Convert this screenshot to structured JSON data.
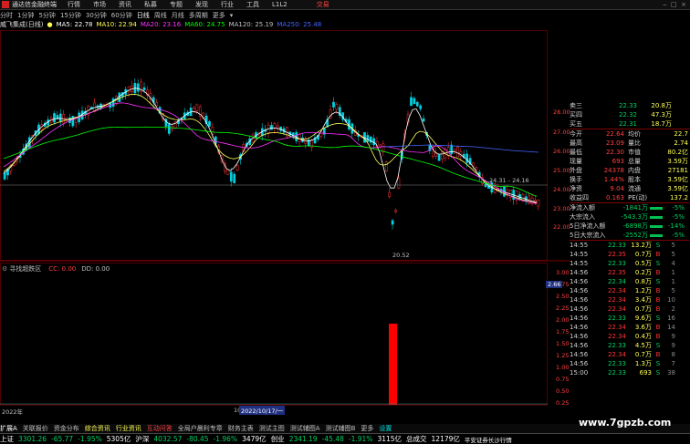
{
  "titlebar": {
    "app_name": "通达信金融终端",
    "menu": [
      "行情",
      "市场",
      "资讯",
      "私募",
      "专题",
      "发现",
      "行业",
      "工具",
      "L1L2"
    ],
    "trade_label": "交易"
  },
  "timeframes": [
    "分时",
    "1分钟",
    "5分钟",
    "15分钟",
    "30分钟",
    "60分钟",
    "日线",
    "周线",
    "月线",
    "多周期",
    "更多"
  ],
  "active_timeframe": "日线",
  "ma_bar": {
    "stock": "威飞集成(日线)",
    "items": [
      {
        "label": "MA5: 22.78",
        "color": "#ffffff"
      },
      {
        "label": "MA10: 22.94",
        "color": "#ffff55"
      },
      {
        "label": "MA20: 23.16",
        "color": "#ff33ff"
      },
      {
        "label": "MA60: 24.75",
        "color": "#00ff00"
      },
      {
        "label": "MA120: 25.19",
        "color": "#c0c0c0"
      },
      {
        "label": "MA250: 25.48",
        "color": "#4466ff"
      }
    ]
  },
  "price_axis": [
    "28.00",
    "27.00",
    "26.00",
    "25.00",
    "24.00",
    "23.00",
    "22.00"
  ],
  "annotations": {
    "high_label": "24.31 - 24.16",
    "low_label": "20.52"
  },
  "indicator": {
    "title": "寻找超跌区",
    "cc_label": "CC: 0.00",
    "dd_label": "DD: 0.00",
    "marker": "2.66",
    "axis": [
      "3.00",
      "2.75",
      "2.50",
      "2.25",
      "2.00",
      "1.75",
      "1.50",
      "1.25",
      "1.00",
      "0.75",
      "0.50",
      "0.25"
    ]
  },
  "date_axis": {
    "left": "2022年",
    "mark": "10",
    "cursor": "2022/10/17/一"
  },
  "quote": {
    "top_rows": [
      {
        "label": "卖三",
        "price": "22.33",
        "vol": "20.8万"
      },
      {
        "label": "买四",
        "price": "22.32",
        "vol": "47.3万"
      },
      {
        "label": "买五",
        "price": "22.31",
        "vol": "18.7万"
      }
    ],
    "stats": [
      {
        "l1": "今开",
        "v1": "22.64",
        "l2": "均价",
        "v2": "22.7"
      },
      {
        "l1": "最高",
        "v1": "23.09",
        "l2": "量比",
        "v2": "2.74"
      },
      {
        "l1": "最低",
        "v1": "22.30",
        "l2": "市值",
        "v2": "80.2亿"
      },
      {
        "l1": "现量",
        "v1": "693",
        "l2": "总量",
        "v2": "3.59万"
      },
      {
        "l1": "外盘",
        "v1": "24378",
        "l2": "内盘",
        "v2": "27181"
      },
      {
        "l1": "换手",
        "v1": "1.44%",
        "l2": "股本",
        "v2": "3.59亿"
      },
      {
        "l1": "净资",
        "v1": "9.04",
        "l2": "流通",
        "v2": "3.59亿"
      },
      {
        "l1": "收益四",
        "v1": "0.163",
        "l2": "PE(动)",
        "v2": "137.2"
      }
    ],
    "flows": [
      {
        "label": "净流入额",
        "value": "-1841万",
        "pct": "-5%"
      },
      {
        "label": "大宗流入",
        "value": "-543.3万",
        "pct": "-5%"
      },
      {
        "label": "5日净流入额",
        "value": "-6898万",
        "pct": "-14%"
      },
      {
        "label": "5日大宗流入",
        "value": "-2552万",
        "pct": "-5%"
      }
    ],
    "ticks": [
      {
        "time": "14:55",
        "price": "22.33",
        "vol": "13.2万",
        "side": "S",
        "n": "5",
        "pc": "#00d060"
      },
      {
        "time": "14:55",
        "price": "22.35",
        "vol": "0.7万",
        "side": "B",
        "n": "5",
        "pc": "#ff3333"
      },
      {
        "time": "14:55",
        "price": "22.33",
        "vol": "0.5万",
        "side": "S",
        "n": "4",
        "pc": "#00d060"
      },
      {
        "time": "14:56",
        "price": "22.35",
        "vol": "0.2万",
        "side": "B",
        "n": "1",
        "pc": "#ff3333"
      },
      {
        "time": "14:56",
        "price": "22.34",
        "vol": "0.8万",
        "side": "S",
        "n": "1",
        "pc": "#00d060"
      },
      {
        "time": "14:56",
        "price": "22.34",
        "vol": "1.2万",
        "side": "B",
        "n": "5",
        "pc": "#ff3333"
      },
      {
        "time": "14:56",
        "price": "22.34",
        "vol": "3.4万",
        "side": "B",
        "n": "10",
        "pc": "#ff3333"
      },
      {
        "time": "14:56",
        "price": "22.34",
        "vol": "0.7万",
        "side": "B",
        "n": "2",
        "pc": "#ff3333"
      },
      {
        "time": "14:56",
        "price": "22.33",
        "vol": "9.6万",
        "side": "S",
        "n": "16",
        "pc": "#00d060"
      },
      {
        "time": "14:56",
        "price": "22.34",
        "vol": "3.6万",
        "side": "B",
        "n": "14",
        "pc": "#ff3333"
      },
      {
        "time": "14:56",
        "price": "22.34",
        "vol": "0.4万",
        "side": "B",
        "n": "9",
        "pc": "#ff3333"
      },
      {
        "time": "14:56",
        "price": "22.33",
        "vol": "4.5万",
        "side": "S",
        "n": "9",
        "pc": "#00d060"
      },
      {
        "time": "14:56",
        "price": "22.34",
        "vol": "0.7万",
        "side": "B",
        "n": "8",
        "pc": "#ff3333"
      },
      {
        "time": "14:56",
        "price": "22.33",
        "vol": "1.3万",
        "side": "S",
        "n": "7",
        "pc": "#00d060"
      },
      {
        "time": "15:00",
        "price": "22.33",
        "vol": "693",
        "side": "S",
        "n": "38",
        "pc": "#00d060"
      }
    ],
    "ticks_footer": "横板 ▶"
  },
  "tabs": [
    "扩展A",
    "关联报价",
    "资金分布",
    "综合资讯",
    "行业资讯",
    "互动问答",
    "全局户晨利专章",
    "财务主表",
    "测试主图",
    "测试辅图A",
    "测试辅图B",
    "更多",
    "设置"
  ],
  "status": {
    "sh_label": "上证",
    "sh_val": "3301.26",
    "sh_chg": "-65.77",
    "sh_pct": "-1.95%",
    "sh_amt": "5305亿",
    "sz_label": "沪深",
    "sz_val": "4032.57",
    "sz_chg": "-80.45",
    "sz_pct": "-1.96%",
    "sz_amt": "3479亿",
    "cy_label": "创业",
    "cy_val": "2341.19",
    "cy_chg": "-45.48",
    "cy_pct": "-1.91%",
    "cy_amt": "3115亿",
    "trade_label": "总成交",
    "trade_val": "12179亿",
    "news": "平安证券长沙行情",
    "watermark": "www.7gpzb.com"
  },
  "chart_data": {
    "type": "candlestick",
    "x": [
      "2022/07",
      "2022/08",
      "2022/09",
      "2022/10/17",
      "2022/11",
      "2022/12"
    ],
    "price_range": [
      21.5,
      28.5
    ],
    "indicator_range": [
      0,
      3.0
    ],
    "indicator_bar": {
      "x": "2022/10/17",
      "value": 2.0
    }
  }
}
